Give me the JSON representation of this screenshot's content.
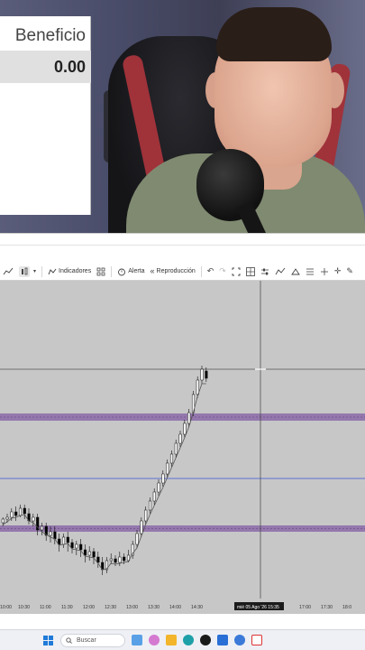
{
  "profit_panel": {
    "header": "Beneficio",
    "value": "0.00"
  },
  "toolbar": {
    "indicators_label": "Indicadores",
    "alert_label": "Alerta",
    "replay_label": "Reproducción"
  },
  "chart": {
    "time_labels": [
      "10:00",
      "10:30",
      "11:00",
      "11:30",
      "12:00",
      "12:30",
      "13:00",
      "13:30",
      "14:00",
      "14:30",
      "16:30",
      "17:00",
      "17:30",
      "18:0"
    ],
    "crosshair_label": "mié 05 Ago '26   15:35",
    "colors": {
      "background": "#c7c7c7",
      "zone_fill": "#8b6aa8",
      "blue_line": "#3a55d8",
      "candle_up": "#ffffff",
      "candle_down": "#000000",
      "moving_average": "#555555"
    }
  },
  "chart_data": {
    "type": "candlestick",
    "x": [
      "10:00",
      "10:30",
      "11:00",
      "11:30",
      "12:00",
      "12:30",
      "13:00",
      "13:30",
      "14:00",
      "14:30"
    ],
    "series": [],
    "grid": false
  },
  "taskbar": {
    "search_placeholder": "Buscar"
  }
}
